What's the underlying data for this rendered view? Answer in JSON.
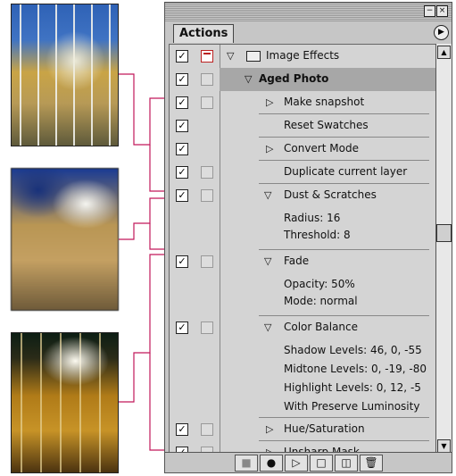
{
  "panel": {
    "tab_label": "Actions",
    "minimize_icon": "−",
    "close_icon": "×",
    "menu_icon": "▶"
  },
  "rows": [
    {
      "label": "Image Effects",
      "checked": "✓"
    },
    {
      "label": "Aged Photo",
      "checked": "✓"
    },
    {
      "label": "Make snapshot",
      "checked": "✓"
    },
    {
      "label": "Reset Swatches",
      "checked": "✓"
    },
    {
      "label": "Convert Mode",
      "checked": "✓"
    },
    {
      "label": "Duplicate current layer",
      "checked": "✓"
    },
    {
      "label": "Dust & Scratches",
      "checked": "✓"
    },
    {
      "label": "Radius: 16"
    },
    {
      "label": "Threshold: 8"
    },
    {
      "label": "Fade",
      "checked": "✓"
    },
    {
      "label": "Opacity: 50%"
    },
    {
      "label": "Mode: normal"
    },
    {
      "label": "Color Balance",
      "checked": "✓"
    },
    {
      "label": "Shadow Levels: 46, 0, -55"
    },
    {
      "label": "Midtone Levels: 0, -19, -80"
    },
    {
      "label": "Highlight Levels: 0, 12, -5"
    },
    {
      "label": "With Preserve Luminosity"
    },
    {
      "label": "Hue/Saturation",
      "checked": "✓"
    },
    {
      "label": "Unsharp Mask",
      "checked": "✓"
    }
  ],
  "toolbar": {
    "stop": "■",
    "record": "●",
    "play": "▷",
    "new_set": "□",
    "new_action": "◫",
    "delete": "🗑"
  },
  "icons": {
    "expanded": "▽",
    "collapsed": "▷"
  },
  "colors": {
    "connector": "#c2185b"
  }
}
